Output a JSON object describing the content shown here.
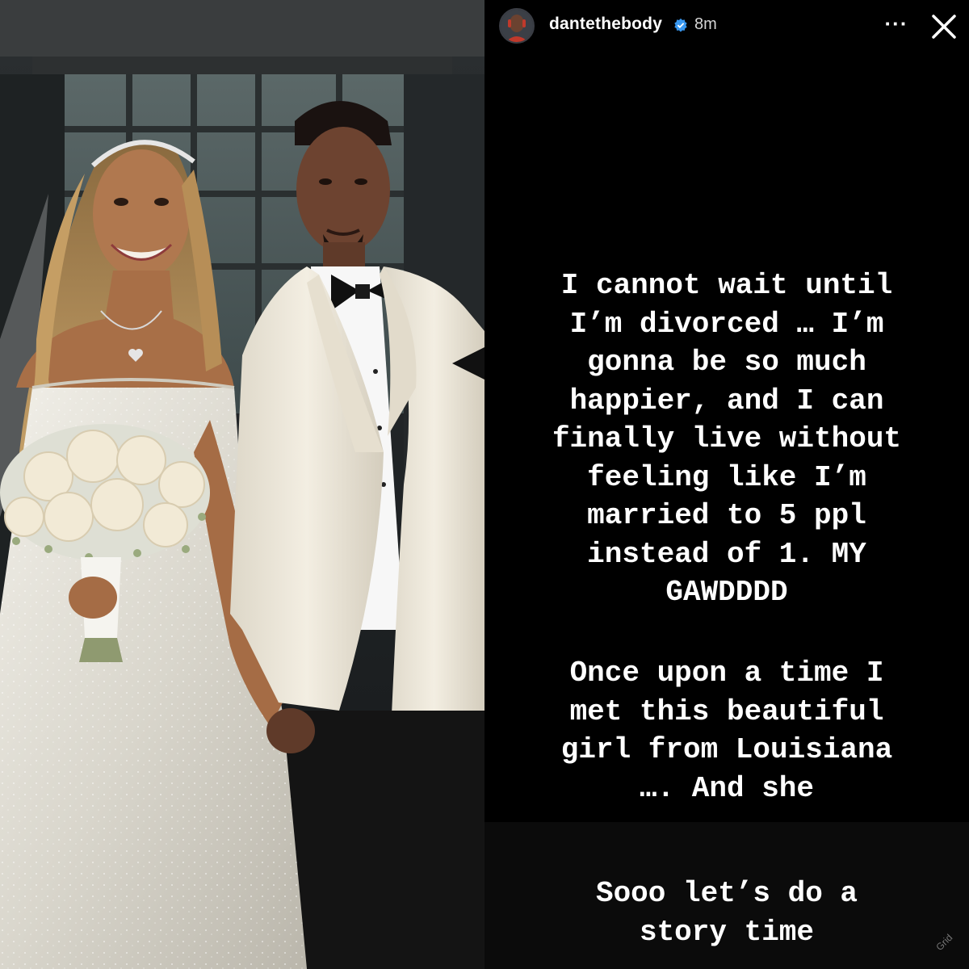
{
  "story": {
    "username": "dantethebody",
    "time_ago": "8m",
    "more_label": "···",
    "paragraphs": [
      "I cannot wait until\nI’m divorced … I’m\ngonna be so much\nhappier, and I can\nfinally live without\nfeeling like I’m\nmarried to 5 ppl\ninstead of 1. MY\nGAWDDDD",
      "Once upon a time I\nmet this beautiful\ngirl from Louisiana\n…. And she",
      "Sooo let’s  do a\nstory time"
    ],
    "watermark": "Grid"
  },
  "colors": {
    "background": "#000000",
    "text": "#ffffff",
    "verified_badge": "#3897f0",
    "gown": "#e9e6dc",
    "jacket": "#f1ece0"
  },
  "icons": {
    "verified": "verified-badge-icon",
    "more": "more-options-icon",
    "close": "close-icon"
  }
}
